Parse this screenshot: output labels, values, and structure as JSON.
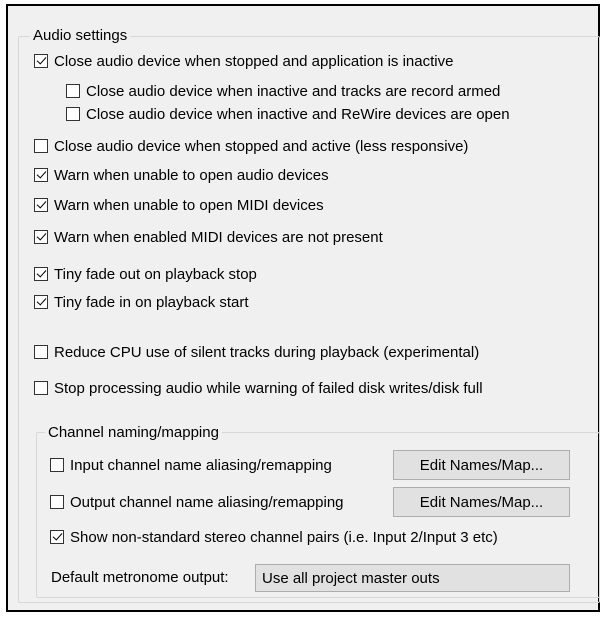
{
  "audio_settings": {
    "title": "Audio settings",
    "options": [
      {
        "label": "Close audio device when stopped and application is inactive",
        "checked": true
      },
      {
        "label": "Close audio device when inactive and tracks are record armed",
        "checked": false
      },
      {
        "label": "Close audio device when inactive and ReWire devices are open",
        "checked": false
      },
      {
        "label": "Close audio device when stopped and active (less responsive)",
        "checked": false
      },
      {
        "label": "Warn when unable to open audio devices",
        "checked": true
      },
      {
        "label": "Warn when unable to open MIDI devices",
        "checked": true
      },
      {
        "label": "Warn when enabled MIDI devices are not present",
        "checked": true
      },
      {
        "label": "Tiny fade out on playback stop",
        "checked": true
      },
      {
        "label": "Tiny fade in on playback start",
        "checked": true
      },
      {
        "label": "Reduce CPU use of silent tracks during playback (experimental)",
        "checked": false
      },
      {
        "label": "Stop processing audio while warning of failed disk writes/disk full",
        "checked": false
      }
    ]
  },
  "channel_mapping": {
    "title": "Channel naming/mapping",
    "input_aliasing": {
      "label": "Input channel name aliasing/remapping",
      "checked": false,
      "button": "Edit Names/Map..."
    },
    "output_aliasing": {
      "label": "Output channel name aliasing/remapping",
      "checked": false,
      "button": "Edit Names/Map..."
    },
    "nonstandard_pairs": {
      "label": "Show non-standard stereo channel pairs (i.e. Input 2/Input 3 etc)",
      "checked": true
    },
    "metronome": {
      "label": "Default metronome output:",
      "value": "Use all project master outs"
    }
  }
}
